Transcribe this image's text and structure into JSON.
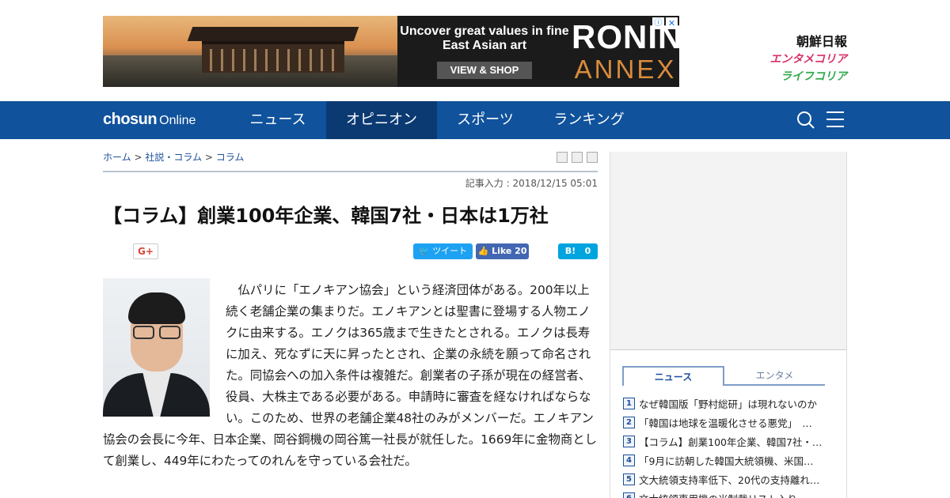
{
  "ad": {
    "tagline": "Uncover great values in fine East Asian art",
    "cta": "VIEW & SHOP",
    "brand_line1": "RONIN",
    "brand_line2": "ANNEX",
    "info": "ⓘ",
    "close": "✕"
  },
  "sites": {
    "chosun": "朝鮮日報",
    "entame": "エンタメコリア",
    "life": "ライフコリア"
  },
  "nav": {
    "logo_bold": "chosun",
    "logo_light": "Online",
    "items": [
      "ニュース",
      "オピニオン",
      "スポーツ",
      "ランキング"
    ],
    "active": "オピニオン"
  },
  "breadcrumb": [
    "ホーム",
    "社説・コラム",
    "コラム"
  ],
  "breadcrumb_sep": ">",
  "date": "記事入力 : 2018/12/15 05:01",
  "headline": "【コラム】創業100年企業、韓国7社・日本は1万社",
  "share": {
    "gplus": "G+",
    "tweet": "ツイート",
    "fb_like": "Like",
    "fb_count": "20",
    "hatena": "B!",
    "hatena_count": "0"
  },
  "article": {
    "paragraph": "　仏パリに「エノキアン協会」という経済団体がある。200年以上続く老舗企業の集まりだ。エノキアンとは聖書に登場する人物エノクに由来する。エノクは365歳まで生きたとされる。エノクは長寿に加え、死なずに天に昇ったとされ、企業の永続を願って命名された。同協会への加入条件は複雑だ。創業者の子孫が現在の経営者、役員、大株主である必要がある。申請時に審査を経なければならない。このため、世界の老舗企業48社のみがメンバーだ。エノキアン協会の会長に今年、日本企業、岡谷鋼機の岡谷篤一社長が就任した。1669年に金物商として創業し、449年にわたってのれんを守っている会社だ。"
  },
  "sidebar": {
    "tabs": [
      "ニュース",
      "エンタメ"
    ],
    "ranking": [
      {
        "num": "1",
        "text": "なぜ韓国版「野村総研」は現れないのか"
      },
      {
        "num": "2",
        "text": "「韓国は地球を温暖化させる悪党」　…"
      },
      {
        "num": "3",
        "text": "【コラム】創業100年企業、韓国7社・…"
      },
      {
        "num": "4",
        "text": "「9月に訪朝した韓国大統領機、米国…"
      },
      {
        "num": "5",
        "text": "文大統領支持率低下、20代の支持離れ…"
      },
      {
        "num": "6",
        "text": "文大統領専用機の米制裁リスト入り…"
      }
    ]
  },
  "colors": {
    "nav_bg": "#10529c",
    "nav_active": "#0b3a73",
    "link": "#1b4f9a",
    "twitter": "#1da1f2",
    "facebook": "#4267b2",
    "hatena": "#00a4de"
  }
}
